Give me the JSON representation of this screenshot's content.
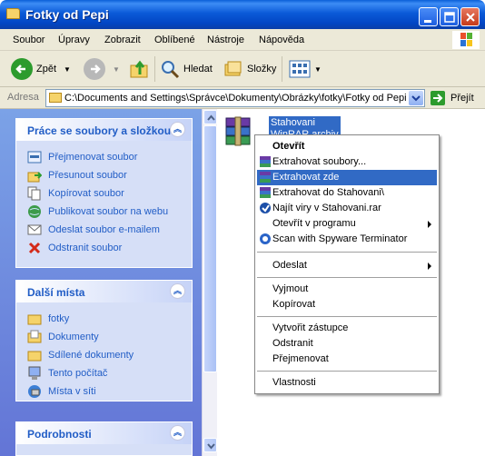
{
  "window": {
    "title": "Fotky od Pepi"
  },
  "menu": [
    "Soubor",
    "Úpravy",
    "Zobrazit",
    "Oblíbené",
    "Nástroje",
    "Nápověda"
  ],
  "toolbar": {
    "back": "Zpět",
    "search": "Hledat",
    "folders": "Složky"
  },
  "address": {
    "label": "Adresa",
    "path": "C:\\Documents and Settings\\Správce\\Dokumenty\\Obrázky\\fotky\\Fotky od Pepi",
    "go": "Přejít"
  },
  "panels": {
    "tasks": {
      "title": "Práce se soubory a složkou",
      "items": [
        "Přejmenovat soubor",
        "Přesunout soubor",
        "Kopírovat soubor",
        "Publikovat soubor na webu",
        "Odeslat soubor e-mailem",
        "Odstranit soubor"
      ]
    },
    "places": {
      "title": "Další místa",
      "items": [
        "fotky",
        "Dokumenty",
        "Sdílené dokumenty",
        "Tento počítač",
        "Místa v síti"
      ]
    },
    "details": {
      "title": "Podrobnosti"
    }
  },
  "file": {
    "name": "Stahovani",
    "type": "WinRAR archiv"
  },
  "context_menu": {
    "open": "Otevřít",
    "extract_files": "Extrahovat soubory...",
    "extract_here": "Extrahovat zde",
    "extract_to": "Extrahovat do Stahovani\\",
    "scan_viruses": "Najít viry v Stahovani.rar",
    "open_with": "Otevřít v programu",
    "spyware": "Scan with Spyware Terminator",
    "send_to": "Odeslat",
    "cut": "Vyjmout",
    "copy": "Kopírovat",
    "shortcut": "Vytvořit zástupce",
    "delete": "Odstranit",
    "rename": "Přejmenovat",
    "properties": "Vlastnosti"
  }
}
